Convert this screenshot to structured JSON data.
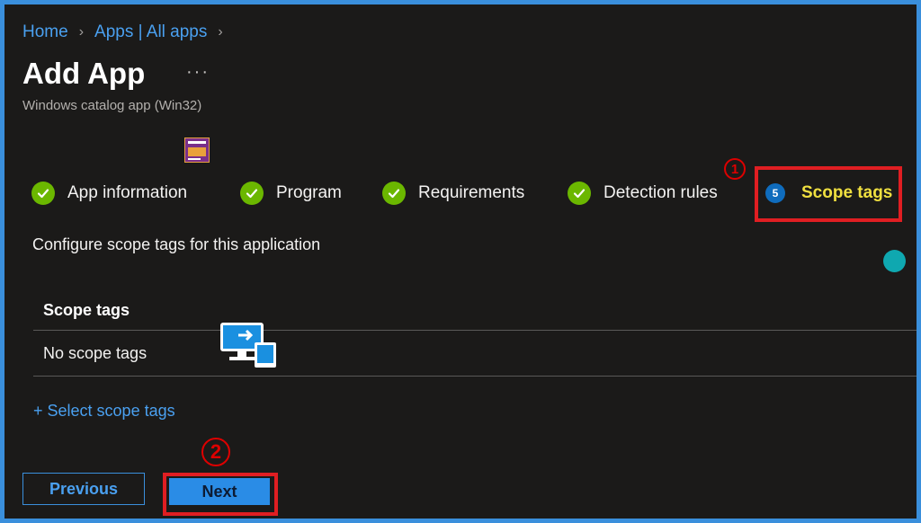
{
  "breadcrumb": {
    "home": "Home",
    "apps": "Apps | All apps"
  },
  "page": {
    "title": "Add App",
    "more": "···",
    "subtitle": "Windows catalog app (Win32)"
  },
  "steps": [
    {
      "label": "App information",
      "state": "complete"
    },
    {
      "label": "Program",
      "state": "complete"
    },
    {
      "label": "Requirements",
      "state": "complete"
    },
    {
      "label": "Detection rules",
      "state": "complete"
    },
    {
      "label": "Scope tags",
      "number": "5",
      "state": "active"
    }
  ],
  "annotations": {
    "one": "1",
    "two": "2"
  },
  "content": {
    "description": "Configure scope tags for this application",
    "table_header": "Scope tags",
    "table_empty": "No scope tags",
    "select_link": "+ Select scope tags"
  },
  "buttons": {
    "previous": "Previous",
    "next": "Next"
  },
  "colors": {
    "accent": "#3a8fdc",
    "link": "#4aa0f0",
    "success": "#6bb700",
    "active_step": "#f0e040",
    "highlight": "#e01e22",
    "background": "#1b1a19"
  }
}
